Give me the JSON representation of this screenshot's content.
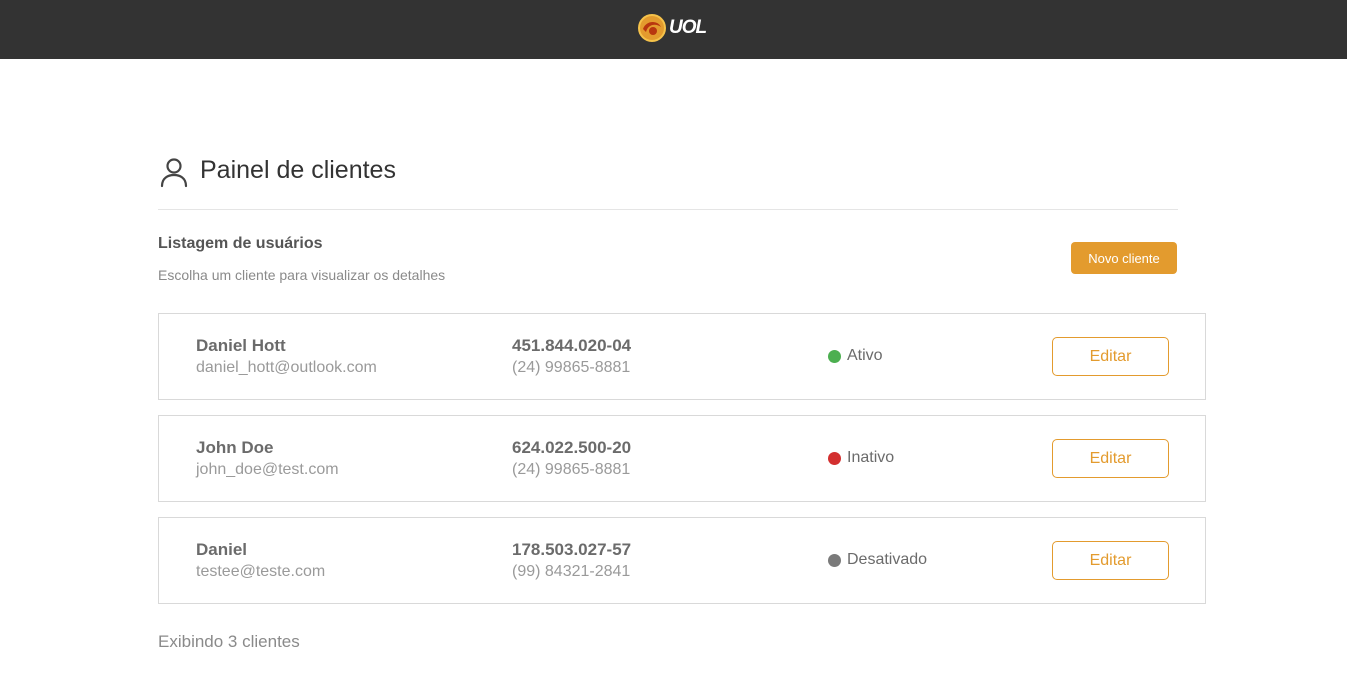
{
  "topbar": {
    "brand": "UOL",
    "brand_color": "#e39b2e",
    "bar_color": "#333333"
  },
  "header": {
    "title": "Painel de clientes",
    "icon": "user-icon"
  },
  "list": {
    "title": "Listagem de usuários",
    "subtitle": "Escolha um cliente para visualizar os detalhes",
    "new_button": "Novo cliente"
  },
  "clients": [
    {
      "name": "Daniel Hott",
      "email": "daniel_hott@outlook.com",
      "cpf": "451.844.020-04",
      "phone": "(24) 99865-8881",
      "status": "Ativo",
      "status_color": "#4caf50",
      "edit": "Editar"
    },
    {
      "name": "John Doe",
      "email": "john_doe@test.com",
      "cpf": "624.022.500-20",
      "phone": "(24) 99865-8881",
      "status": "Inativo",
      "status_color": "#d32f2f",
      "edit": "Editar"
    },
    {
      "name": "Daniel",
      "email": "testee@teste.com",
      "cpf": "178.503.027-57",
      "phone": "(99) 84321-2841",
      "status": "Desativado",
      "status_color": "#7a7a7a",
      "edit": "Editar"
    }
  ],
  "footer": {
    "count_text": "Exibindo 3 clientes"
  }
}
